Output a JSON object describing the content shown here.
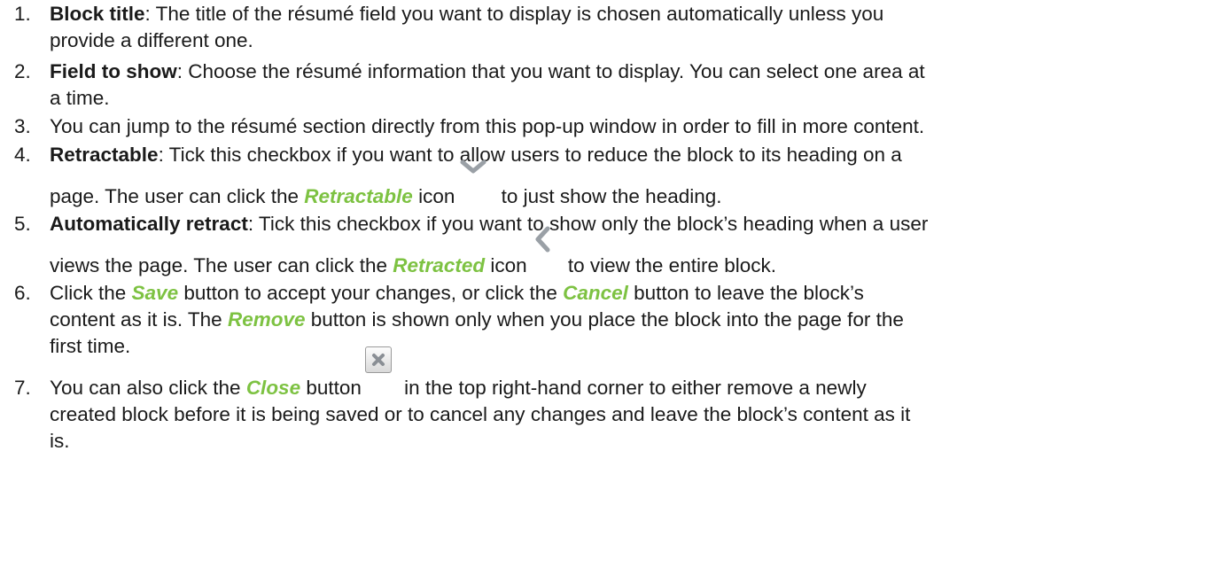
{
  "colors": {
    "text": "#1a1a1a",
    "ui_label": "#7dc242"
  },
  "items": [
    {
      "number": "1.",
      "term": "Block title",
      "line1_rest": ": The title of the résumé field you want to display is chosen automatically unless you",
      "line2": "provide a different one."
    },
    {
      "number": "2.",
      "term": "Field to show",
      "line1_rest": ": Choose the résumé information that you want to display. You can select one area at",
      "line2": "a time."
    },
    {
      "number": "3.",
      "line1": "You can jump to the résumé section directly from this pop-up window in order to fill in more content."
    },
    {
      "number": "4.",
      "term": "Retractable",
      "line1_rest": ": Tick this checkbox if you want to allow users to reduce the block to its heading on a",
      "line2_a": "page. The user can click the ",
      "line2_ui": "Retractable",
      "line2_b": " icon",
      "line2_c": " to just show the heading.",
      "icon": "chevron-down-icon"
    },
    {
      "number": "5.",
      "term": "Automatically retract",
      "line1_rest": ": Tick this checkbox if you want to show only the block’s heading when a user",
      "line2_a": "views the page. The user can click the ",
      "line2_ui": "Retracted",
      "line2_b": " icon",
      "line2_c": " to view the entire block.",
      "icon": "chevron-left-icon"
    },
    {
      "number": "6.",
      "line1_a": "Click the ",
      "line1_ui1": "Save",
      "line1_b": " button to accept your changes, or click the ",
      "line1_ui2": "Cancel",
      "line1_c": " button to leave the block’s",
      "line2_a": "content as it is. The ",
      "line2_ui": "Remove",
      "line2_b": " button is shown only when you place the block into the page for the",
      "line3": "first time."
    },
    {
      "number": "7.",
      "line1_a": "You can also click the ",
      "line1_ui": "Close",
      "line1_b": " button",
      "line1_c": " in the top right-hand corner to either remove a newly",
      "line2": "created block before it is being saved or to cancel any changes and leave the block’s content as it",
      "line3": "is.",
      "icon": "close-button-icon"
    }
  ]
}
